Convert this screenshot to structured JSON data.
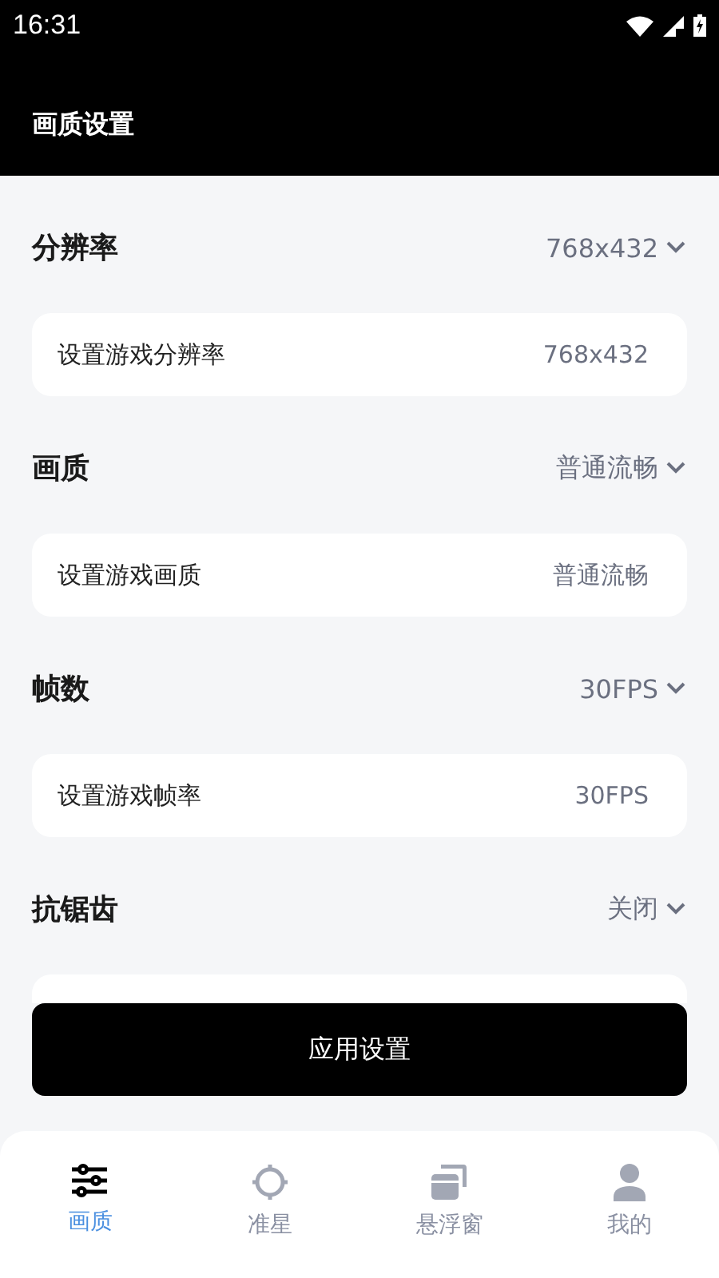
{
  "status_bar": {
    "time": "16:31"
  },
  "header": {
    "title": "画质设置"
  },
  "settings": [
    {
      "label": "分辨率",
      "value": "768x432",
      "row_label": "设置游戏分辨率",
      "row_value": "768x432"
    },
    {
      "label": "画质",
      "value": "普通流畅",
      "row_label": "设置游戏画质",
      "row_value": "普通流畅"
    },
    {
      "label": "帧数",
      "value": "30FPS",
      "row_label": "设置游戏帧率",
      "row_value": "30FPS"
    },
    {
      "label": "抗锯齿",
      "value": "关闭"
    }
  ],
  "apply_button": "应用设置",
  "tabs": [
    {
      "kind": "sliders",
      "label": "画质",
      "selected": true
    },
    {
      "kind": "crosshair",
      "label": "准星",
      "selected": false
    },
    {
      "kind": "windows",
      "label": "悬浮窗",
      "selected": false
    },
    {
      "kind": "person",
      "label": "我的",
      "selected": false
    }
  ]
}
